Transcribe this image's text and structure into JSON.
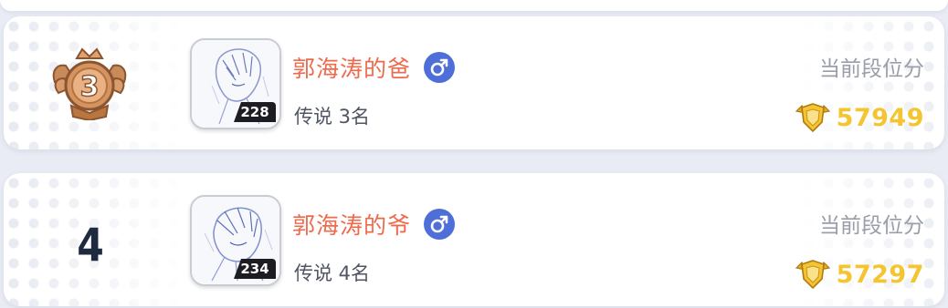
{
  "leaderboard": {
    "entries": [
      {
        "rank": "3",
        "rank_display": "medal",
        "avatar_level": "228",
        "name": "郭海涛的爸",
        "gender": "male",
        "tier": "传说 3名",
        "score_label": "当前段位分",
        "score": "57949"
      },
      {
        "rank": "4",
        "rank_display": "number",
        "avatar_level": "234",
        "name": "郭海涛的爷",
        "gender": "male",
        "tier": "传说 4名",
        "score_label": "当前段位分",
        "score": "57297"
      }
    ]
  },
  "colors": {
    "name": "#ef6a4c",
    "gender_male": "#4f6fd8",
    "score": "#f4c431",
    "medal_bronze": "#c98a5a"
  },
  "icons": {
    "gender": "male-symbol-icon",
    "score": "gold-shield-icon",
    "rank_3": "bronze-medal-icon"
  }
}
